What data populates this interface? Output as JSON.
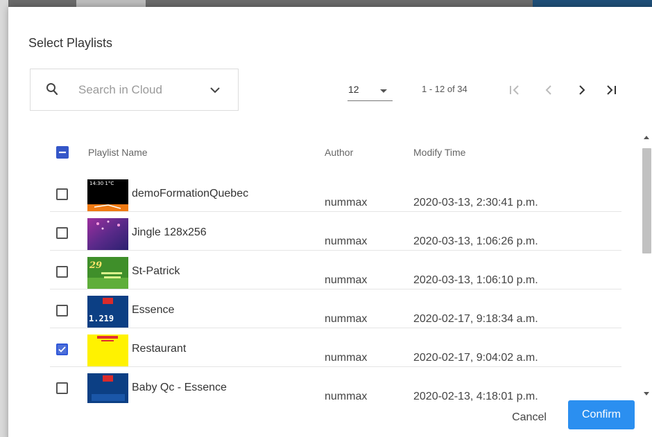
{
  "dialog": {
    "title": "Select Playlists",
    "search": {
      "placeholder": "Search in Cloud"
    },
    "pager": {
      "page_size": "12",
      "range_text": "1 - 12 of 34",
      "first_icon": "first-page-icon",
      "prev_icon": "chevron-left-icon",
      "next_icon": "chevron-right-icon",
      "last_icon": "last-page-icon"
    },
    "columns": {
      "name": "Playlist Name",
      "author": "Author",
      "modify": "Modify Time"
    },
    "rows": [
      {
        "name": "demoFormationQuebec",
        "author": "nummax",
        "modified": "2020-03-13, 2:30:41 p.m.",
        "checked": false,
        "thumb_text": "14:30  1°C"
      },
      {
        "name": "Jingle 128x256",
        "author": "nummax",
        "modified": "2020-03-13, 1:06:26 p.m.",
        "checked": false,
        "thumb_text": ""
      },
      {
        "name": "St-Patrick",
        "author": "nummax",
        "modified": "2020-03-13, 1:06:10 p.m.",
        "checked": false,
        "thumb_text": "29"
      },
      {
        "name": "Essence",
        "author": "nummax",
        "modified": "2020-02-17, 9:18:34 a.m.",
        "checked": false,
        "thumb_text": "1.219"
      },
      {
        "name": "Restaurant",
        "author": "nummax",
        "modified": "2020-02-17, 9:04:02 a.m.",
        "checked": true,
        "thumb_text": ""
      },
      {
        "name": "Baby Qc - Essence",
        "author": "nummax",
        "modified": "2020-02-13, 4:18:01 p.m.",
        "checked": false,
        "thumb_text": ""
      }
    ],
    "buttons": {
      "cancel": "Cancel",
      "confirm": "Confirm"
    },
    "colors": {
      "accent": "#2b8ff0",
      "checkbox": "#3456c8"
    }
  }
}
